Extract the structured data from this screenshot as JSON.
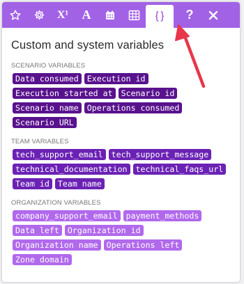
{
  "toolbar": {
    "tools": [
      {
        "icon": "star-icon"
      },
      {
        "icon": "gear-icon"
      },
      {
        "icon": "superscript-icon",
        "label": "X¹"
      },
      {
        "icon": "text-icon",
        "label": "A"
      },
      {
        "icon": "calendar-icon"
      },
      {
        "icon": "table-icon"
      },
      {
        "icon": "variables-icon",
        "label": "{}",
        "active": true
      },
      {
        "icon": "help-icon",
        "label": "?"
      },
      {
        "icon": "close-icon"
      }
    ]
  },
  "panel": {
    "title": "Custom and system variables",
    "sections": [
      {
        "heading": "SCENARIO VARIABLES",
        "variables": [
          "Data consumed",
          "Execution id",
          "Execution started at",
          "Scenario id",
          "Scenario name",
          "Operations consumed",
          "Scenario URL"
        ]
      },
      {
        "heading": "TEAM VARIABLES",
        "variables": [
          "tech_support_email",
          "tech_support_message",
          "technical_documentation",
          "technical_faqs_url",
          "Team id",
          "Team name"
        ]
      },
      {
        "heading": "ORGANIZATION VARIABLES",
        "variables": [
          "company_support_email",
          "payment_methods",
          "Data left",
          "Organization id",
          "Organization name",
          "Operations left",
          "Zone domain"
        ]
      }
    ]
  },
  "colors": {
    "toolbar": "#a262e6",
    "scenario_chip": "#59128e",
    "team_chip": "#6b22b4",
    "organization_chip": "#b169ec",
    "arrow": "#e8364a"
  }
}
